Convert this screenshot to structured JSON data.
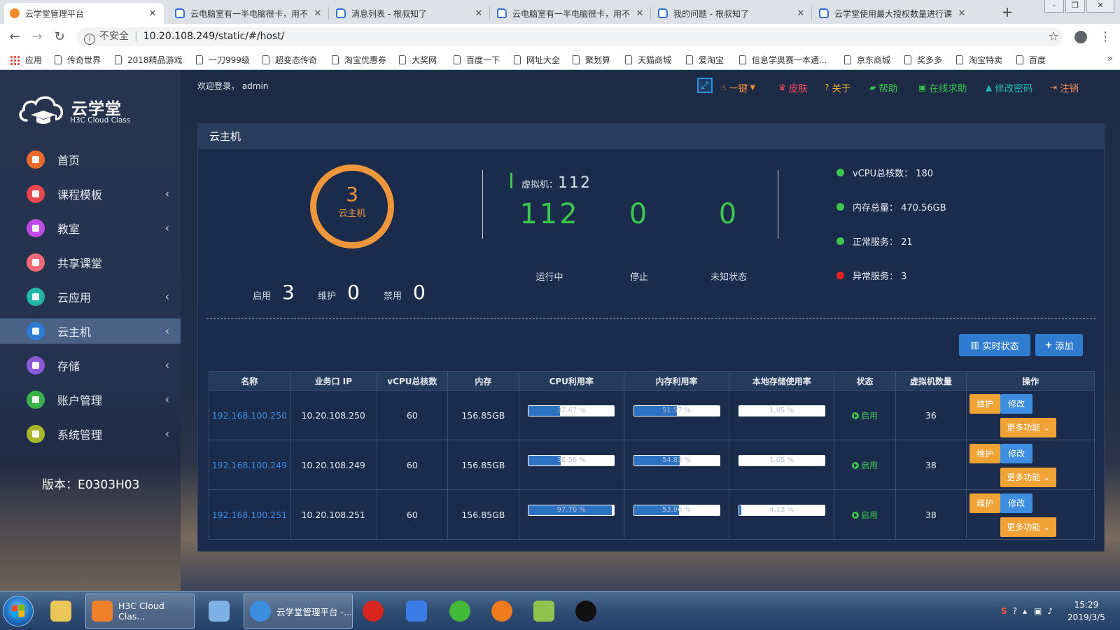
{
  "browser": {
    "tabs": [
      {
        "title": "云学堂管理平台",
        "icon": "cloud",
        "active": true
      },
      {
        "title": "云电脑室有一半电脑很卡，用不",
        "icon": "doc"
      },
      {
        "title": "消息列表 - 根叔知了",
        "icon": "doc"
      },
      {
        "title": "云电脑室有一半电脑很卡，用不",
        "icon": "doc"
      },
      {
        "title": "我的问题 - 根叔知了",
        "icon": "doc"
      },
      {
        "title": "云学堂使用最大授权数量进行课",
        "icon": "doc"
      }
    ],
    "new_tab": "+",
    "security_label": "不安全",
    "url": "10.20.108.249/static/#/host/",
    "bookmarks": [
      "应用",
      "传奇世界",
      "2018精品游戏",
      "一刀999级",
      "超变态传奇",
      "淘宝优惠券",
      "大奖网",
      "百度一下",
      "网址大全",
      "聚划算",
      "天猫商城",
      "爱淘宝",
      "信息学奥赛一本通...",
      "京东商城",
      "奖多多",
      "淘宝特卖",
      "百度"
    ],
    "bookmarks_more": "»"
  },
  "sidebar": {
    "brand": "云学堂",
    "brand_sub": "H3C Cloud Class",
    "items": [
      {
        "label": "首页",
        "icon": "home-icon",
        "color": "#ee6a2b",
        "chevron": false
      },
      {
        "label": "课程模板",
        "icon": "template-icon",
        "color": "#e8474d",
        "chevron": true
      },
      {
        "label": "教室",
        "icon": "classroom-icon",
        "color": "#c04be6",
        "chevron": true
      },
      {
        "label": "共享课堂",
        "icon": "share-icon",
        "color": "#f06a7a",
        "chevron": false
      },
      {
        "label": "云应用",
        "icon": "cloud-app-icon",
        "color": "#23b5a5",
        "chevron": true
      },
      {
        "label": "云主机",
        "icon": "host-icon",
        "color": "#2c7bd6",
        "chevron": true,
        "active": true
      },
      {
        "label": "存储",
        "icon": "storage-icon",
        "color": "#8a5ad8",
        "chevron": true
      },
      {
        "label": "账户管理",
        "icon": "account-icon",
        "color": "#39b24a",
        "chevron": true
      },
      {
        "label": "系统管理",
        "icon": "settings-icon",
        "color": "#a9b82a",
        "chevron": true
      }
    ],
    "chevron_glyph": "‹",
    "version": "版本：E0303H03"
  },
  "topbar": {
    "welcome": "欢迎登录， admin",
    "links": [
      {
        "label": "一键",
        "icon": "hand-icon",
        "color": "#f08a34",
        "caret": true
      },
      {
        "label": "皮肤",
        "icon": "shirt-icon",
        "color": "#ff4d5e"
      },
      {
        "label": "关于",
        "icon": "question-icon",
        "color": "#f0b433"
      },
      {
        "label": "帮助",
        "icon": "book-icon",
        "color": "#39c24a"
      },
      {
        "label": "在线求助",
        "icon": "camera-icon",
        "color": "#39c24a"
      },
      {
        "label": "修改密码",
        "icon": "lock-icon",
        "color": "#22b7b0"
      },
      {
        "label": "注销",
        "icon": "logout-icon",
        "color": "#f08a5a"
      }
    ]
  },
  "panel": {
    "title": "云主机",
    "hosts": {
      "count": "3",
      "label": "云主机"
    },
    "host_stats": [
      {
        "label": "启用",
        "value": "3"
      },
      {
        "label": "维护",
        "value": "0"
      },
      {
        "label": "禁用",
        "value": "0"
      }
    ],
    "vm": {
      "title_label": "虚拟机：",
      "title_value": "112",
      "counts": [
        {
          "value": "112",
          "label": "运行中"
        },
        {
          "value": "0",
          "label": "停止"
        },
        {
          "value": "0",
          "label": "未知状态"
        }
      ]
    },
    "summary": [
      {
        "text": "vCPU总核数： 180",
        "color": "#3cc74f"
      },
      {
        "text": "内存总量： 470.56GB",
        "color": "#3cc74f"
      },
      {
        "text": "正常服务： 21",
        "color": "#3cc74f"
      },
      {
        "text": "异常服务： 3",
        "color": "#e82222"
      }
    ],
    "buttons": {
      "realtime": "实时状态",
      "add": "添加"
    },
    "table": {
      "headers": [
        "名称",
        "业务口 IP",
        "vCPU总核数",
        "内存",
        "CPU利用率",
        "内存利用率",
        "本地存储使用率",
        "状态",
        "虚拟机数量",
        "操作"
      ],
      "rows": [
        {
          "name": "192.168.100.250",
          "ip": "10.20.108.250",
          "vcpu": "60",
          "mem": "156.85GB",
          "cpu_pct": 37.67,
          "cpu_text": "37.67 %",
          "mem_pct": 51.57,
          "mem_text": "51.57 %",
          "disk_pct": 1.05,
          "disk_text": "1.05 %",
          "status": "启用",
          "vms": "36"
        },
        {
          "name": "192.168.100.249",
          "ip": "10.20.108.249",
          "vcpu": "60",
          "mem": "156.85GB",
          "cpu_pct": 38.5,
          "cpu_text": "38.50 %",
          "mem_pct": 54.83,
          "mem_text": "54.83 %",
          "disk_pct": 1.05,
          "disk_text": "1.05 %",
          "status": "启用",
          "vms": "38"
        },
        {
          "name": "192.168.100.251",
          "ip": "10.20.108.251",
          "vcpu": "60",
          "mem": "156.85GB",
          "cpu_pct": 97.7,
          "cpu_text": "97.70 %",
          "mem_pct": 53.96,
          "mem_text": "53.96 %",
          "disk_pct": 4.13,
          "disk_text": "4.13 %",
          "status": "启用",
          "vms": "38"
        }
      ],
      "ops": {
        "maintain": "维护",
        "edit": "修改",
        "more": "更多功能 ⌄"
      }
    }
  },
  "taskbar": {
    "items": [
      {
        "label": "",
        "icon": "explorer-icon"
      },
      {
        "label": "H3C Cloud Clas...",
        "icon": "h3c-cloud-icon"
      },
      {
        "label": "",
        "icon": "assistant-icon"
      },
      {
        "label": "云学堂管理平台 -...",
        "icon": "chrome-icon"
      },
      {
        "label": "",
        "icon": "flash-icon"
      },
      {
        "label": "",
        "icon": "baidu-netdisk-icon"
      },
      {
        "label": "",
        "icon": "sync-icon"
      },
      {
        "label": "",
        "icon": "firefox-icon"
      },
      {
        "label": "",
        "icon": "pen-icon"
      },
      {
        "label": "",
        "icon": "obs-icon"
      }
    ],
    "time": "15:29",
    "date": "2019/3/5"
  }
}
